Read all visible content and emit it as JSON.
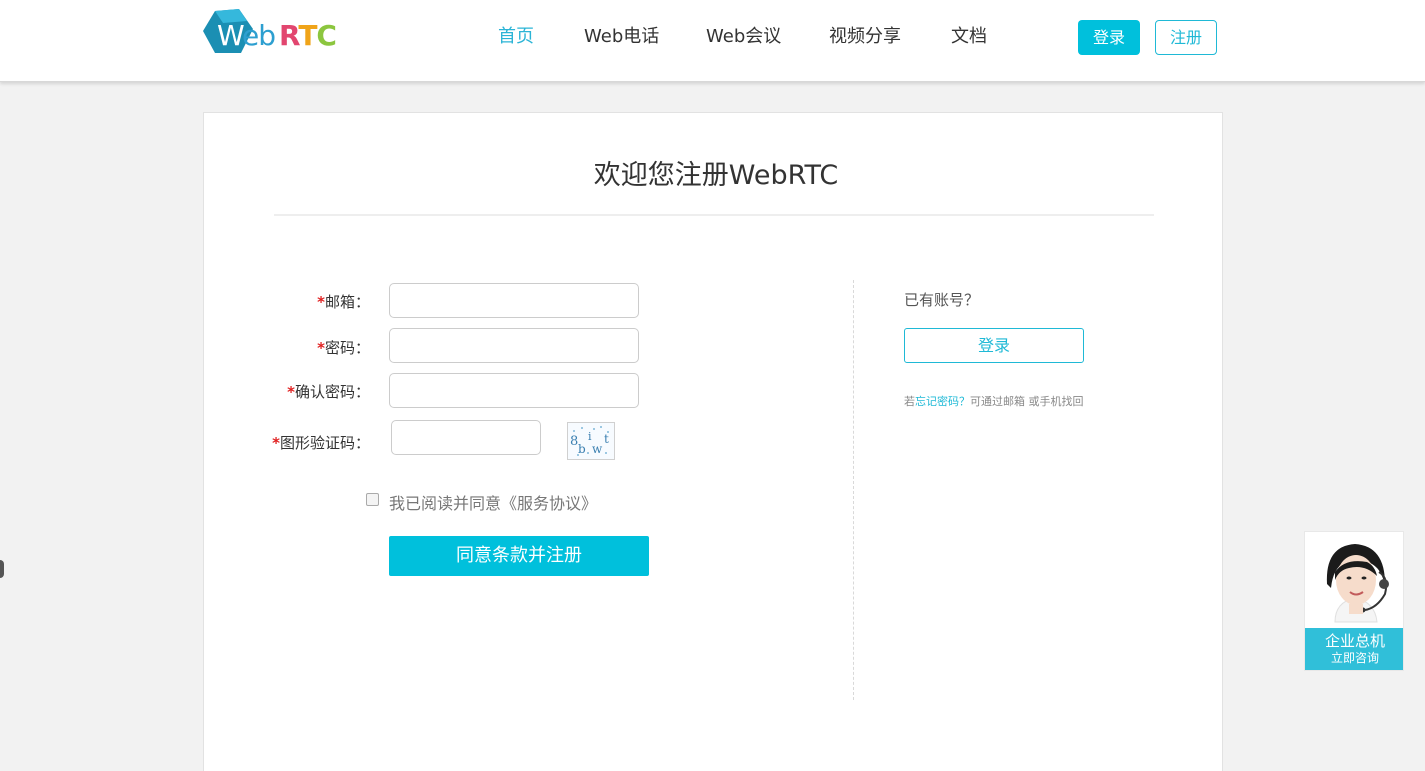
{
  "header": {
    "logo": {
      "web_first": "W",
      "web_rest": "eb",
      "rtc_letters": [
        "R",
        "T",
        "C"
      ],
      "rtc_colors": [
        "#e2466f",
        "#f0a419",
        "#8cc63f"
      ]
    },
    "nav": [
      {
        "label": "首页",
        "active": true
      },
      {
        "label": "Web电话",
        "active": false
      },
      {
        "label": "Web会议",
        "active": false
      },
      {
        "label": "视频分享",
        "active": false
      },
      {
        "label": "文档",
        "active": false
      }
    ],
    "login_label": "登录",
    "register_label": "注册"
  },
  "form": {
    "title": "欢迎您注册WebRTC",
    "required_mark": "*",
    "fields": [
      {
        "label": "邮箱：",
        "value": ""
      },
      {
        "label": "密码：",
        "value": ""
      },
      {
        "label": "确认密码：",
        "value": ""
      },
      {
        "label": "图形验证码：",
        "value": ""
      }
    ],
    "captcha_text": "8ibwt",
    "agree_text": "我已阅读并同意《服务协议》",
    "agree_checked": false,
    "submit_label": "同意条款并注册"
  },
  "side": {
    "have_account": "已有账号？",
    "login_label": "登录",
    "forgot_prefix": "若",
    "forgot_link": "忘记密码？",
    "forgot_suffix": "可通过邮箱 或手机找回"
  },
  "service": {
    "title": "企业总机",
    "subtitle": "立即咨询"
  },
  "colors": {
    "accent": "#00c0dc",
    "link": "#1fb9d6",
    "required": "#e02020"
  }
}
